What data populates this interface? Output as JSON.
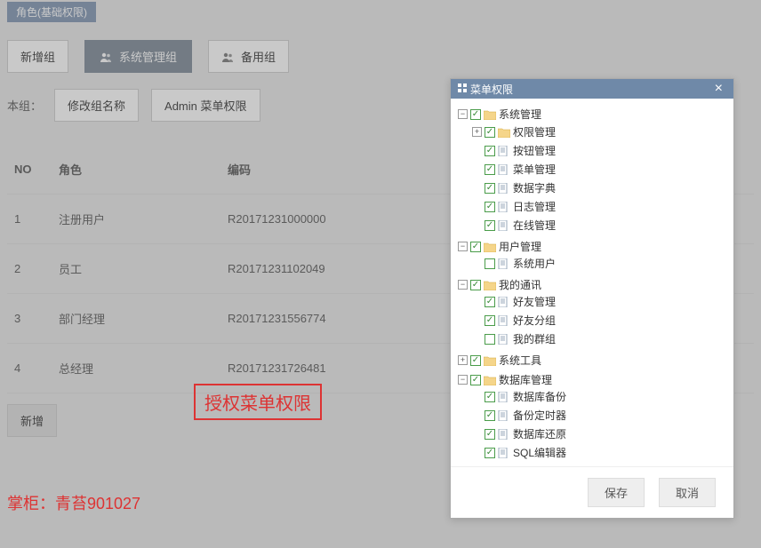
{
  "tab_badge": "角色(基础权限)",
  "toolbar": {
    "new_group": "新增组",
    "sys_admin_group": "系统管理组",
    "backup_group": "备用组"
  },
  "subrow": {
    "label": "本组：",
    "rename": "修改组名称",
    "admin_menu": "Admin 菜单权限"
  },
  "table": {
    "headers": {
      "no": "NO",
      "role": "角色",
      "code": "编码"
    },
    "rows": [
      {
        "no": "1",
        "role": "注册用户",
        "code": "R20171231000000"
      },
      {
        "no": "2",
        "role": "员工",
        "code": "R20171231102049"
      },
      {
        "no": "3",
        "role": "部门经理",
        "code": "R20171231556774"
      },
      {
        "no": "4",
        "role": "总经理",
        "code": "R20171231726481"
      }
    ]
  },
  "add_button": "新增",
  "annotation": "授权菜单权限",
  "footer_note": "掌柜：青苔901027",
  "dialog": {
    "title": "菜单权限",
    "save": "保存",
    "cancel": "取消",
    "tree": [
      {
        "label": "系统管理",
        "type": "folder",
        "checked": true,
        "expand": "-",
        "children": [
          {
            "label": "权限管理",
            "type": "folder",
            "checked": true,
            "expand": "+"
          },
          {
            "label": "按钮管理",
            "type": "file",
            "checked": true
          },
          {
            "label": "菜单管理",
            "type": "file",
            "checked": true
          },
          {
            "label": "数据字典",
            "type": "file",
            "checked": true
          },
          {
            "label": "日志管理",
            "type": "file",
            "checked": true
          },
          {
            "label": "在线管理",
            "type": "file",
            "checked": true
          }
        ]
      },
      {
        "label": "用户管理",
        "type": "folder",
        "checked": true,
        "expand": "-",
        "children": [
          {
            "label": "系统用户",
            "type": "file",
            "checked": false
          }
        ]
      },
      {
        "label": "我的通讯",
        "type": "folder",
        "checked": true,
        "expand": "-",
        "children": [
          {
            "label": "好友管理",
            "type": "file",
            "checked": true
          },
          {
            "label": "好友分组",
            "type": "file",
            "checked": true
          },
          {
            "label": "我的群组",
            "type": "file",
            "checked": false
          }
        ]
      },
      {
        "label": "系统工具",
        "type": "folder",
        "checked": true,
        "expand": "+"
      },
      {
        "label": "数据库管理",
        "type": "folder",
        "checked": true,
        "expand": "-",
        "children": [
          {
            "label": "数据库备份",
            "type": "file",
            "checked": true
          },
          {
            "label": "备份定时器",
            "type": "file",
            "checked": true
          },
          {
            "label": "数据库还原",
            "type": "file",
            "checked": true
          },
          {
            "label": "SQL编辑器",
            "type": "file",
            "checked": true
          }
        ]
      }
    ]
  }
}
